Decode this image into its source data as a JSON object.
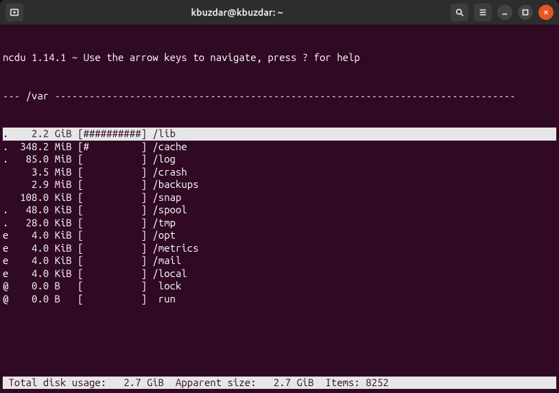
{
  "titlebar": {
    "title": "kbuzdar@kbuzdar: ~"
  },
  "ncdu": {
    "header": "ncdu 1.14.1 ~ Use the arrow keys to navigate, press ? for help",
    "path_prefix": "--- ",
    "path": "/var",
    "rows": [
      {
        "flag": ".",
        "size": "2.2",
        "unit": "GiB",
        "bar": "##########",
        "name": "/lib",
        "selected": true
      },
      {
        "flag": ".",
        "size": "348.2",
        "unit": "MiB",
        "bar": "#         ",
        "name": "/cache"
      },
      {
        "flag": ".",
        "size": "85.0",
        "unit": "MiB",
        "bar": "          ",
        "name": "/log"
      },
      {
        "flag": " ",
        "size": "3.5",
        "unit": "MiB",
        "bar": "          ",
        "name": "/crash"
      },
      {
        "flag": " ",
        "size": "2.9",
        "unit": "MiB",
        "bar": "          ",
        "name": "/backups"
      },
      {
        "flag": " ",
        "size": "108.0",
        "unit": "KiB",
        "bar": "          ",
        "name": "/snap"
      },
      {
        "flag": ".",
        "size": "48.0",
        "unit": "KiB",
        "bar": "          ",
        "name": "/spool"
      },
      {
        "flag": ".",
        "size": "28.0",
        "unit": "KiB",
        "bar": "          ",
        "name": "/tmp"
      },
      {
        "flag": "e",
        "size": "4.0",
        "unit": "KiB",
        "bar": "          ",
        "name": "/opt"
      },
      {
        "flag": "e",
        "size": "4.0",
        "unit": "KiB",
        "bar": "          ",
        "name": "/metrics"
      },
      {
        "flag": "e",
        "size": "4.0",
        "unit": "KiB",
        "bar": "          ",
        "name": "/mail"
      },
      {
        "flag": "e",
        "size": "4.0",
        "unit": "KiB",
        "bar": "          ",
        "name": "/local"
      },
      {
        "flag": "@",
        "size": "0.0",
        "unit": "B",
        "bar": "          ",
        "name": " lock"
      },
      {
        "flag": "@",
        "size": "0.0",
        "unit": "B",
        "bar": "          ",
        "name": " run"
      }
    ],
    "status": {
      "total_label": " Total disk usage:",
      "total_value": "2.7 GiB",
      "apparent_label": "Apparent size:",
      "apparent_value": "2.7 GiB",
      "items_label": "Items:",
      "items_value": "8252"
    }
  }
}
